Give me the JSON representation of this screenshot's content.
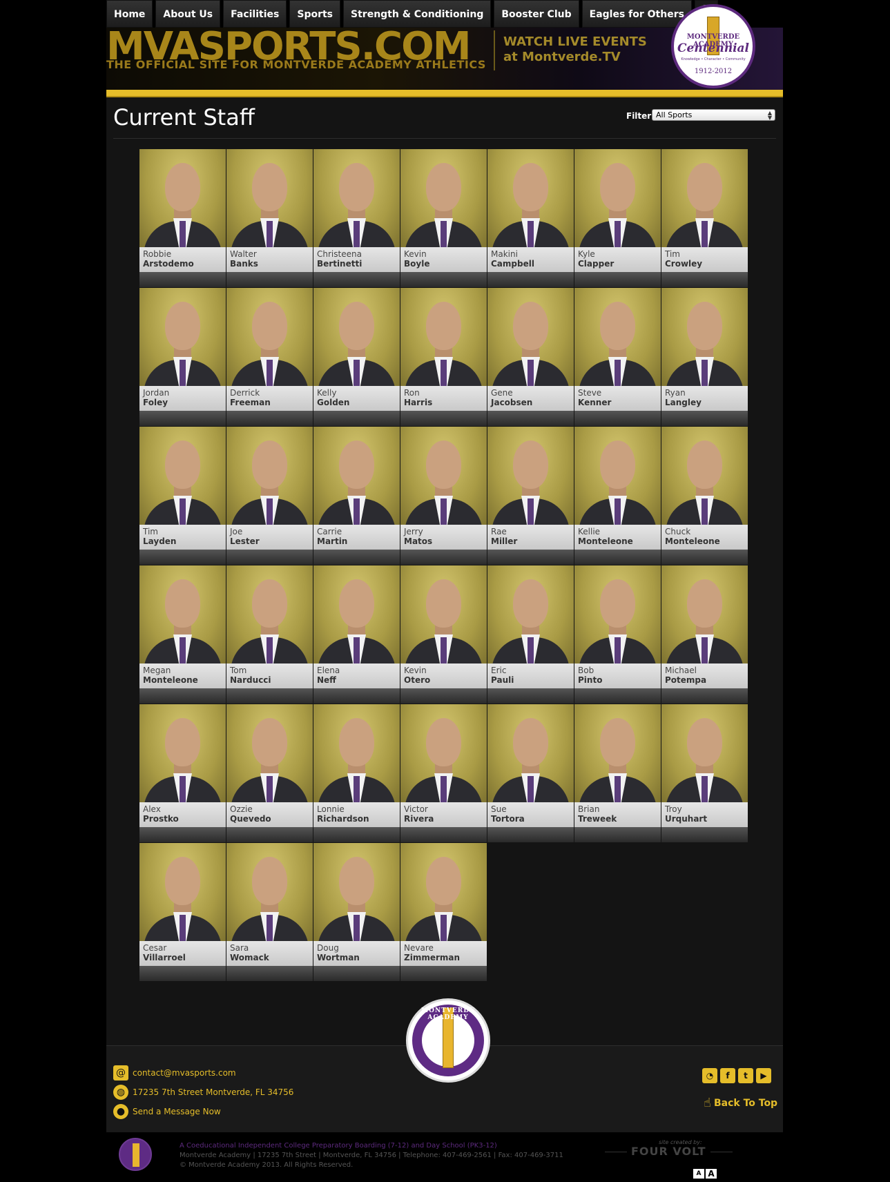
{
  "nav": {
    "items": [
      {
        "label": "Home",
        "name": "nav-home"
      },
      {
        "label": "About Us",
        "name": "nav-about-us"
      },
      {
        "label": "Facilities",
        "name": "nav-facilities"
      },
      {
        "label": "Sports",
        "name": "nav-sports"
      },
      {
        "label": "Strength & Conditioning",
        "name": "nav-strength-conditioning"
      },
      {
        "label": "Booster Club",
        "name": "nav-booster-club"
      },
      {
        "label": "Eagles for Others",
        "name": "nav-eagles-for-others"
      }
    ],
    "search_icon": "search-icon"
  },
  "header": {
    "site_title": "MVASPORTS.COM",
    "tagline": "THE OFFICIAL SITE FOR MONTVERDE ACADEMY ATHLETICS",
    "watch_line_1": "WATCH LIVE EVENTS",
    "watch_line_2": "at Montverde.TV",
    "logo": {
      "top_text": "MONTVERDE ACADEMY",
      "script": "Centennial",
      "motto": "Knowledge • Character • Community",
      "years": "1912-2012"
    }
  },
  "page": {
    "title": "Current Staff",
    "filter_label": "Filter:",
    "filter_value": "All Sports"
  },
  "staff": [
    {
      "first": "Robbie",
      "last": "Arstodemo"
    },
    {
      "first": "Walter",
      "last": "Banks"
    },
    {
      "first": "Christeena",
      "last": "Bertinetti"
    },
    {
      "first": "Kevin",
      "last": "Boyle"
    },
    {
      "first": "Makini",
      "last": "Campbell"
    },
    {
      "first": "Kyle",
      "last": "Clapper"
    },
    {
      "first": "Tim",
      "last": "Crowley"
    },
    {
      "first": "Jordan",
      "last": "Foley"
    },
    {
      "first": "Derrick",
      "last": "Freeman"
    },
    {
      "first": "Kelly",
      "last": "Golden"
    },
    {
      "first": "Ron",
      "last": "Harris"
    },
    {
      "first": "Gene",
      "last": "Jacobsen"
    },
    {
      "first": "Steve",
      "last": "Kenner"
    },
    {
      "first": "Ryan",
      "last": "Langley"
    },
    {
      "first": "Tim",
      "last": "Layden"
    },
    {
      "first": "Joe",
      "last": "Lester"
    },
    {
      "first": "Carrie",
      "last": "Martin"
    },
    {
      "first": "Jerry",
      "last": "Matos"
    },
    {
      "first": "Rae",
      "last": "Miller"
    },
    {
      "first": "Kellie",
      "last": "Monteleone"
    },
    {
      "first": "Chuck",
      "last": "Monteleone"
    },
    {
      "first": "Megan",
      "last": "Monteleone"
    },
    {
      "first": "Tom",
      "last": "Narducci"
    },
    {
      "first": "Elena",
      "last": "Neff"
    },
    {
      "first": "Kevin",
      "last": "Otero"
    },
    {
      "first": "Eric",
      "last": "Pauli"
    },
    {
      "first": "Bob",
      "last": "Pinto"
    },
    {
      "first": "Michael",
      "last": "Potempa"
    },
    {
      "first": "Alex",
      "last": "Prostko"
    },
    {
      "first": "Ozzie",
      "last": "Quevedo"
    },
    {
      "first": "Lonnie",
      "last": "Richardson"
    },
    {
      "first": "Victor",
      "last": "Rivera"
    },
    {
      "first": "Sue",
      "last": "Tortora"
    },
    {
      "first": "Brian",
      "last": "Treweek"
    },
    {
      "first": "Troy",
      "last": "Urquhart"
    },
    {
      "first": "Cesar",
      "last": "Villarroel"
    },
    {
      "first": "Sara",
      "last": "Womack"
    },
    {
      "first": "Doug",
      "last": "Wortman"
    },
    {
      "first": "Nevare",
      "last": "Zimmerman"
    }
  ],
  "footer": {
    "seal_text": "MONTVERDE ACADEMY",
    "email": "contact@mvasports.com",
    "address": "17235 7th Street Montverde, FL 34756",
    "message": "Send a Message Now",
    "social_icons": [
      "rss-icon",
      "facebook-icon",
      "twitter-icon",
      "youtube-icon"
    ],
    "back_to_top": "Back To Top"
  },
  "bottom": {
    "line_1": "A Coeducational Independent College Preparatory Boarding (7-12) and Day School (PK3-12)",
    "line_2": "Montverde Academy | 17235 7th Street | Montverde, FL 34756 | Telephone: 407-469-2561 | Fax: 407-469-3711",
    "line_3": "© Montverde Academy 2013. All Rights Reserved.",
    "credit_label": "site created by:",
    "credit_brand": "FOUR VOLT",
    "text_size_small": "A",
    "text_size_large": "A"
  },
  "colors": {
    "accent_gold": "#e5bd2a",
    "brand_purple": "#5e2b84",
    "panel": "#141414"
  }
}
